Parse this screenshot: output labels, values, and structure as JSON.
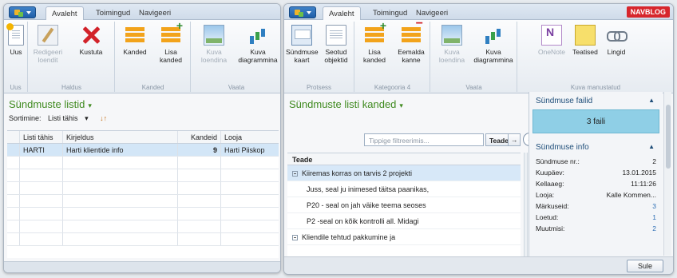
{
  "left": {
    "tabs": [
      "Avaleht",
      "Toimingud",
      "Navigeeri"
    ],
    "ribbon": {
      "buttons": {
        "new": "Uus",
        "edit": "Redigeeri loendit",
        "delete": "Kustuta",
        "records": "Kanded",
        "add_record": "Lisa kanded",
        "show_list": "Kuva loendina",
        "show_chart": "Kuva diagrammina"
      },
      "groups": [
        "Uus",
        "Haldus",
        "Kanded",
        "Vaata"
      ]
    },
    "section_title": "Sündmuste listid",
    "sort_label": "Sortimine:",
    "sort_value": "Listi tähis",
    "table": {
      "columns": [
        "Listi tähis",
        "Kirjeldus",
        "Kandeid",
        "Looja"
      ],
      "rows": [
        [
          "HARTI",
          "Harti klientide info",
          "9",
          "Harti Piiskop"
        ]
      ]
    }
  },
  "right": {
    "tabs": [
      "Avaleht",
      "Toimingud",
      "Navigeeri"
    ],
    "badge": "NAVBLOG",
    "ribbon": {
      "buttons": {
        "event_card": "Sündmuse kaart",
        "related_objects": "Seotud objektid",
        "add_record": "Lisa kanded",
        "remove_record": "Eemalda kanne",
        "show_list": "Kuva loendina",
        "show_chart": "Kuva diagrammina",
        "onenote": "OneNote",
        "notes": "Teatised",
        "links": "Lingid"
      },
      "groups": [
        "Protsess",
        "Kategooria 4",
        "Vaata",
        "Kuva manustatud"
      ]
    },
    "section_title": "Sündmuste listi kanded",
    "filter_placeholder": "Tippige filtreerimis...",
    "filter_field": "Teade",
    "tree": {
      "header": "Teade",
      "items": [
        "Kiiremas korras on tarvis 2 projekti",
        "Juss, seal ju inimesed täitsa paanikas,",
        "P20 - seal on jah väike teema seoses",
        "P2 -seal on kõik kontrolli all. Midagi",
        "Kliendile tehtud pakkumine ja"
      ]
    },
    "files_panel": {
      "title": "Sündmuse failid",
      "value": "3 faili"
    },
    "info_panel": {
      "title": "Sündmuse info",
      "rows": [
        {
          "label": "Sündmuse nr.:",
          "value": "2"
        },
        {
          "label": "Kuupäev:",
          "value": "13.01.2015"
        },
        {
          "label": "Kellaaeg:",
          "value": "11:11:26"
        },
        {
          "label": "Looja:",
          "value": "Kalle Kommen..."
        },
        {
          "label": "Märkuseid:",
          "value": "3"
        },
        {
          "label": "Loetud:",
          "value": "1"
        },
        {
          "label": "Muutmisi:",
          "value": "2"
        }
      ]
    },
    "close_button": "Sule"
  }
}
